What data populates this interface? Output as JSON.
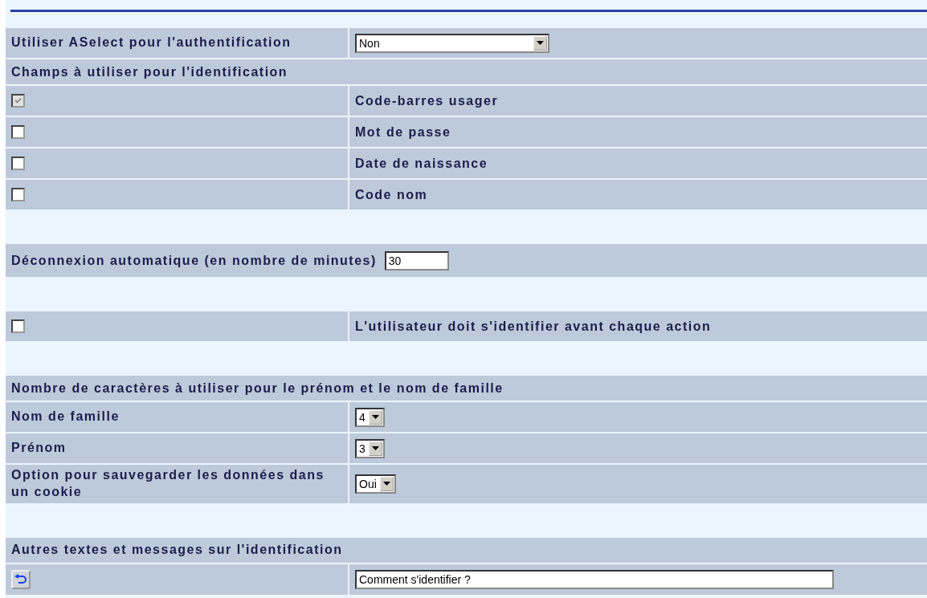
{
  "rows": [
    {
      "kind": "select",
      "label": "Utiliser ASelect pour l'authentification",
      "value": "Non"
    },
    {
      "kind": "header",
      "label": "Champs à utiliser pour l'identification"
    },
    {
      "kind": "checkbox",
      "label": "Code-barres usager",
      "checked": true,
      "disabled": true
    },
    {
      "kind": "checkbox",
      "label": "Mot de passe",
      "checked": false,
      "disabled": false
    },
    {
      "kind": "checkbox",
      "label": "Date de naissance",
      "checked": false,
      "disabled": false
    },
    {
      "kind": "checkbox",
      "label": "Code nom",
      "checked": false,
      "disabled": false
    },
    {
      "kind": "spacer"
    },
    {
      "kind": "input",
      "label": "Déconnexion automatique (en nombre de minutes)",
      "value": "30"
    },
    {
      "kind": "spacer"
    },
    {
      "kind": "checkbox",
      "label": "L'utilisateur doit s'identifier avant chaque action",
      "checked": false,
      "disabled": false
    },
    {
      "kind": "spacer"
    },
    {
      "kind": "header",
      "label": "Nombre de caractères à utiliser pour le prénom et le nom de famille"
    },
    {
      "kind": "select",
      "label": "Nom de famille",
      "value": "4"
    },
    {
      "kind": "select",
      "label": "Prénom",
      "value": "3"
    },
    {
      "kind": "select",
      "label": "Option pour sauvegarder les données dans un cookie",
      "value": "Oui"
    },
    {
      "kind": "spacer"
    },
    {
      "kind": "header",
      "label": "Autres textes et messages sur l'identification"
    },
    {
      "kind": "undo-input",
      "value": "Comment s'identifier ?"
    }
  ]
}
